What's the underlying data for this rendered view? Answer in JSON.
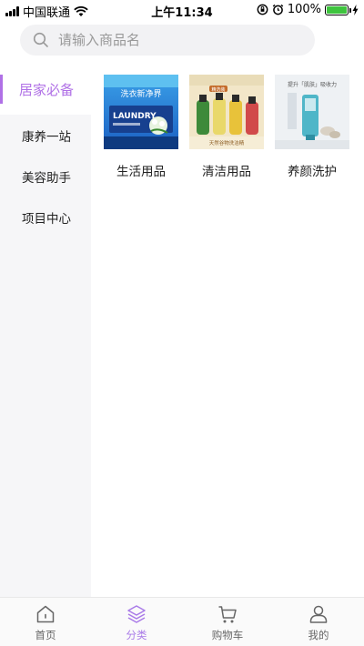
{
  "status_bar": {
    "carrier": "中国联通",
    "time": "上午11:34",
    "battery": "100%"
  },
  "search": {
    "placeholder": "请输入商品名"
  },
  "sidebar": {
    "items": [
      {
        "label": "居家必备",
        "active": true
      },
      {
        "label": "康养一站",
        "active": false
      },
      {
        "label": "美容助手",
        "active": false
      },
      {
        "label": "项目中心",
        "active": false
      }
    ]
  },
  "categories": [
    {
      "label": "生活用品",
      "image_text": "洗衣新净界",
      "image_sub": "LAUNDRY"
    },
    {
      "label": "清洁用品",
      "image_text": "天然谷物洗洁精",
      "image_sub": "精选装"
    },
    {
      "label": "养颜洗护",
      "image_text": "提升「肌肤」吸收力"
    }
  ],
  "tabbar": {
    "items": [
      {
        "label": "首页",
        "icon": "home-icon"
      },
      {
        "label": "分类",
        "icon": "category-layers-icon",
        "active": true
      },
      {
        "label": "购物车",
        "icon": "cart-icon"
      },
      {
        "label": "我的",
        "icon": "user-icon"
      }
    ]
  },
  "colors": {
    "accent": "#b070e6",
    "sidebar_bg": "#f6f6f8",
    "battery": "#3ec43e"
  }
}
